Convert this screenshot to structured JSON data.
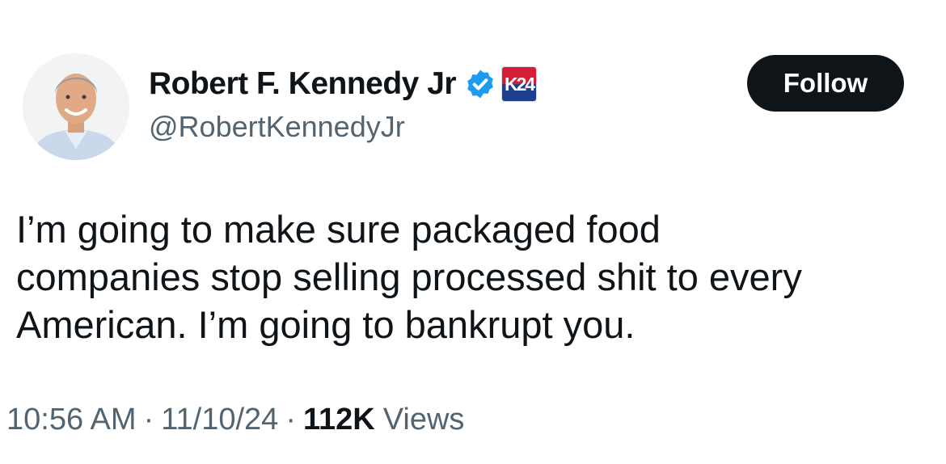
{
  "author": {
    "display_name": "Robert F. Kennedy Jr",
    "handle": "@RobertKennedyJr",
    "verified_icon": "verified-badge-icon",
    "affiliate_badge": "K24"
  },
  "follow_button": {
    "label": "Follow"
  },
  "tweet": {
    "lines": [
      "I’m going to make sure packaged food",
      "companies stop selling processed shit to every",
      "American. I’m going to bankrupt you."
    ]
  },
  "meta": {
    "time": "10:56 AM",
    "separator": "·",
    "date": "11/10/24",
    "views_count": "112K",
    "views_label": "Views"
  },
  "colors": {
    "text_primary": "#0f1419",
    "text_secondary": "#536471",
    "verified_blue": "#1d9bf0",
    "button_bg": "#0f1419",
    "badge_red": "#d51d38",
    "badge_blue": "#1d3f8f"
  }
}
